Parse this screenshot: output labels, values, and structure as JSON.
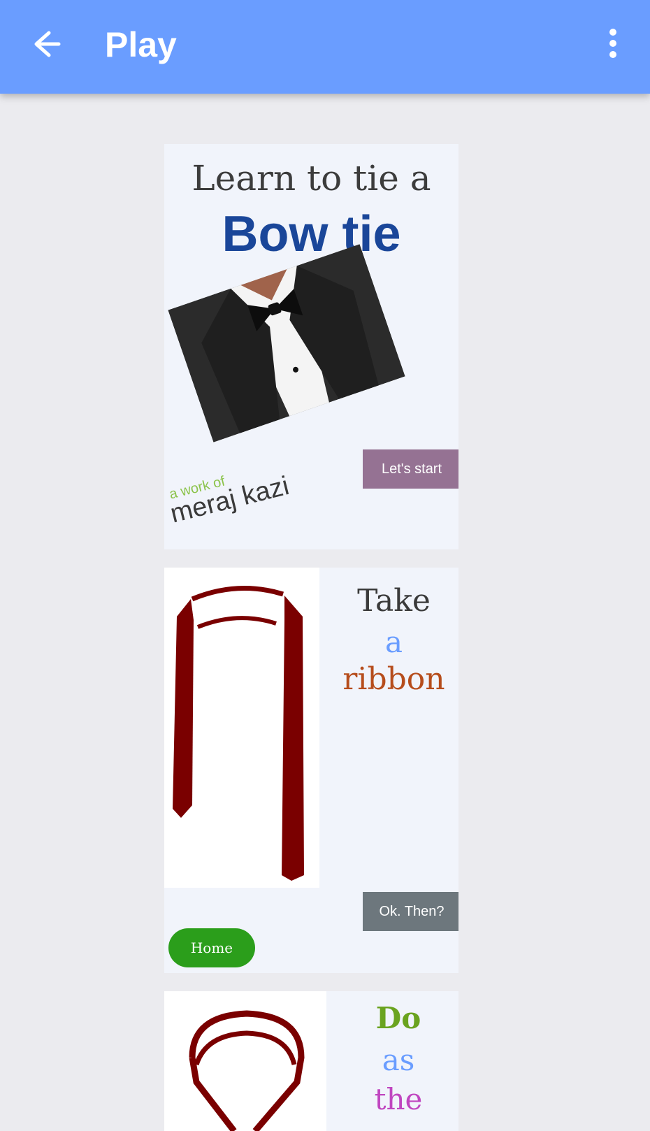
{
  "appbar": {
    "title": "Play",
    "back_icon": "arrow-left-icon",
    "menu_icon": "more-vert-icon",
    "color": "#6a9dff"
  },
  "card_intro": {
    "heading_line1": "Learn to tie a",
    "heading_line2": "Bow tie",
    "credit_prefix": "a work of",
    "credit_name": "meraj kazi",
    "start_button": "Let's start"
  },
  "card_step1": {
    "line1": "Take",
    "line2": "a",
    "line3": "ribbon",
    "next_button": "Ok. Then?",
    "home_button": "Home"
  },
  "card_step2": {
    "line1": "Do",
    "line2": "as",
    "line3": "the"
  }
}
